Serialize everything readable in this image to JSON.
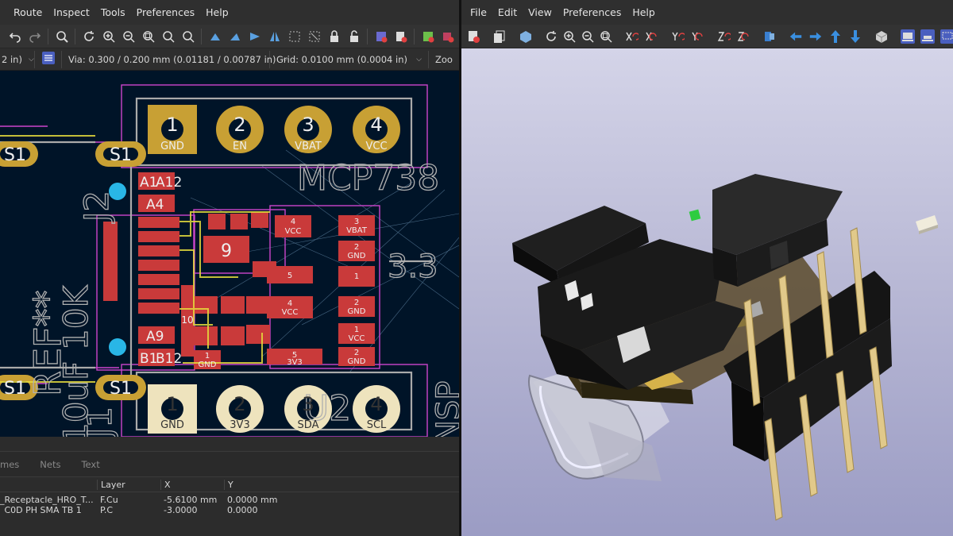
{
  "pcb_editor": {
    "menu": [
      "Route",
      "Inspect",
      "Tools",
      "Preferences",
      "Help"
    ],
    "options": {
      "width": "2 in)",
      "via": "Via: 0.300 / 0.200 mm (0.01181 / 0.00787 in)",
      "grid": "Grid: 0.0100 mm (0.0004 in)",
      "zoom": "Zoo"
    },
    "board": {
      "silk_texts": [
        "MCP738",
        "J2",
        "REF**",
        "10uF",
        "10K",
        "U2",
        "J1",
        "NSP",
        "3.3"
      ],
      "header_pins": [
        {
          "num": "1",
          "net": "GND"
        },
        {
          "num": "2",
          "net": "EN"
        },
        {
          "num": "3",
          "net": "VBAT"
        },
        {
          "num": "4",
          "net": "VCC"
        }
      ],
      "i2c_pins": [
        {
          "num": "1",
          "net": "GND"
        },
        {
          "num": "2",
          "net": "3V3"
        },
        {
          "num": "3",
          "net": "SDA"
        },
        {
          "num": "4",
          "net": "SCL"
        }
      ],
      "shield_pads": [
        "S1",
        "S1",
        "S1",
        "S1"
      ],
      "usb_pads": [
        "A1",
        "A12",
        "A4",
        "A9",
        "B1",
        "B12"
      ],
      "center_pad": "9",
      "smd_pads": [
        {
          "num": "4",
          "net": "VCC"
        },
        {
          "num": "3",
          "net": "VBAT"
        },
        {
          "num": "2",
          "net": "GND"
        },
        {
          "num": "1",
          "net": ""
        },
        {
          "num": "5",
          "net": ""
        },
        {
          "num": "4",
          "net": "VCC"
        },
        {
          "num": "2",
          "net": "GND"
        },
        {
          "num": "1",
          "net": "VCC"
        },
        {
          "num": "5",
          "net": "3V3"
        },
        {
          "num": "2",
          "net": "GND"
        },
        {
          "num": "1",
          "net": "GND"
        },
        {
          "num": "10",
          "net": ""
        }
      ]
    },
    "properties": {
      "tabs": [
        "mes",
        "Nets",
        "Text"
      ],
      "columns": [
        "Layer",
        "X",
        "Y"
      ],
      "rows": [
        {
          "name": "_Receptacle_HRO_T...",
          "layer": "F.Cu",
          "x": "-5.6100 mm",
          "y": "0.0000 mm"
        },
        {
          "name": "_C0D PH SMA TB 1",
          "layer": "P.C",
          "x": "-3.0000",
          "y": "0.0000"
        }
      ]
    }
  },
  "viewer_3d": {
    "menu": [
      "File",
      "Edit",
      "View",
      "Preferences",
      "Help"
    ]
  },
  "colors": {
    "pcb_bg": "#001428",
    "pad_gold": "#c8a034",
    "smd_red": "#c93a3a",
    "silk": "#d8d8d8",
    "outline_magenta": "#cc44cc"
  }
}
